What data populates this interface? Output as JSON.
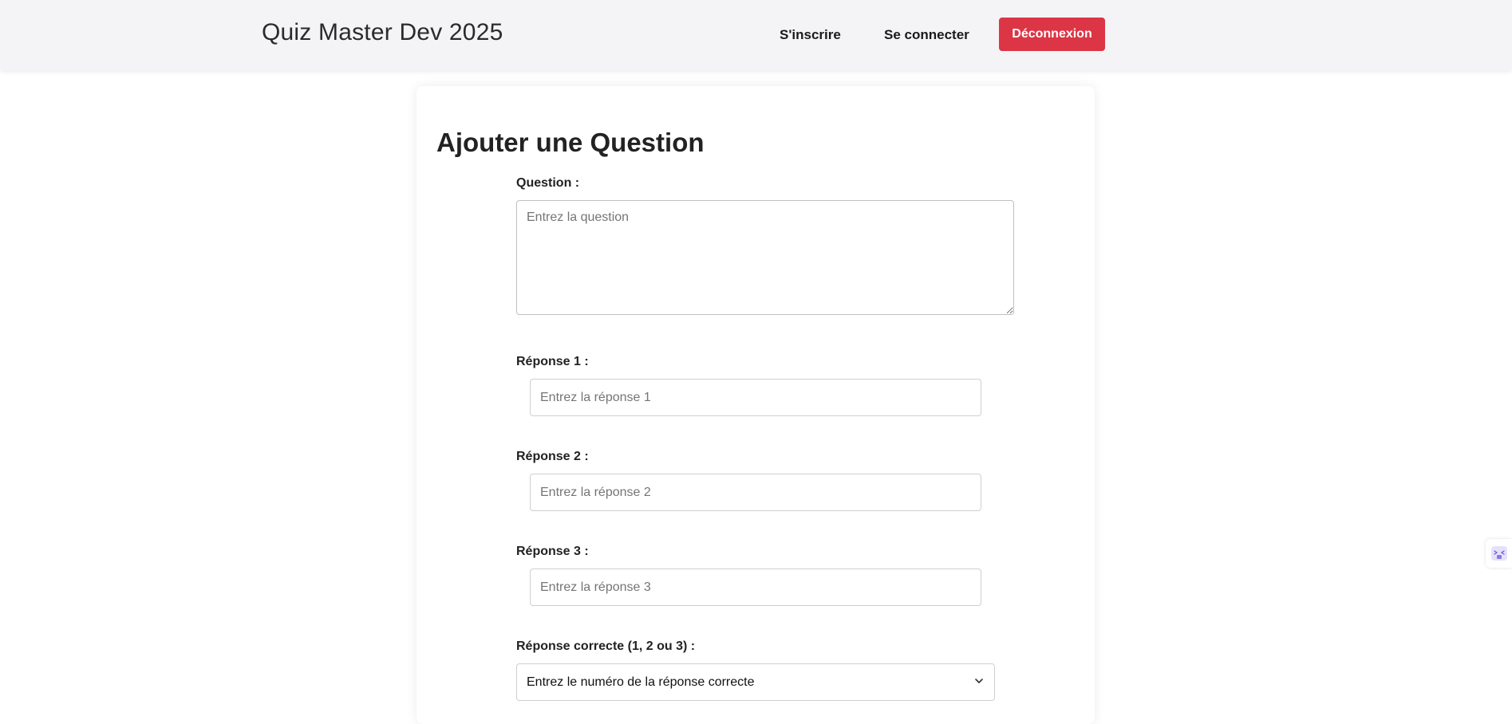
{
  "navbar": {
    "brand": "Quiz Master Dev 2025",
    "signup_label": "S'inscrire",
    "login_label": "Se connecter",
    "logout_label": "Déconnexion"
  },
  "form": {
    "title": "Ajouter une Question",
    "question_label": "Question :",
    "question_placeholder": "Entrez la question",
    "answer1_label": "Réponse 1 :",
    "answer1_placeholder": "Entrez la réponse 1",
    "answer2_label": "Réponse 2 :",
    "answer2_placeholder": "Entrez la réponse 2",
    "answer3_label": "Réponse 3 :",
    "answer3_placeholder": "Entrez la réponse 3",
    "correct_label": "Réponse correcte (1, 2 ou 3) :",
    "correct_selected": "Entrez le numéro de la réponse correcte"
  },
  "colors": {
    "navbar_bg": "#f4f4f6",
    "logout_bg": "#dc3545"
  },
  "icons": {
    "select_chevron": "chevron-down-icon",
    "side_widget": "extension-icon"
  }
}
